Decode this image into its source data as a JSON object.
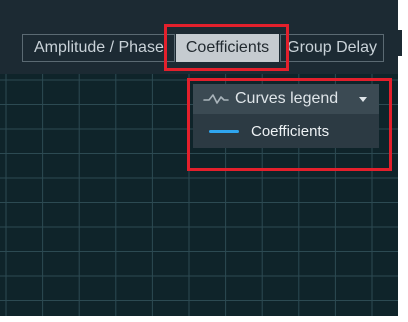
{
  "tabs": [
    {
      "label": "Amplitude / Phase",
      "active": false
    },
    {
      "label": "Coefficients",
      "active": true
    },
    {
      "label": "Group Delay",
      "active": false
    }
  ],
  "legend": {
    "title": "Curves legend",
    "icon": "waveform-icon",
    "toggle_icon": "caret-down-icon",
    "entries": [
      {
        "label": "Coefficients",
        "color": "#2fa6f0"
      }
    ]
  },
  "colors": {
    "panel_background": "#1c2a33",
    "plot_background": "#0f242a",
    "grid": "#2c4a52",
    "active_tab": "#c5cbd0",
    "highlight": "#e3202c"
  }
}
